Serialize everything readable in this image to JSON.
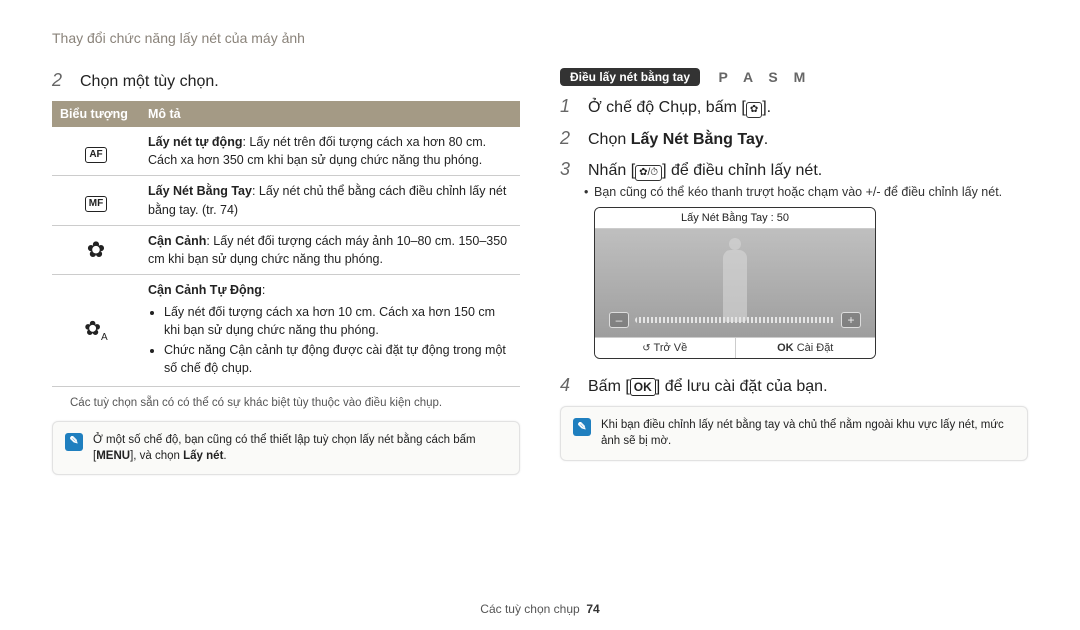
{
  "header": {
    "topic": "Thay đổi chức năng lấy nét của máy ảnh"
  },
  "left": {
    "step_number": "2",
    "step_text": "Chọn một tùy chọn.",
    "table_headers": {
      "icon": "Biểu tượng",
      "desc": "Mô tả"
    },
    "rows": [
      {
        "icon_label": "AF",
        "title": "Lấy nét tự động",
        "body": ": Lấy nét trên đối tượng cách xa hơn 80 cm. Cách xa hơn 350 cm khi bạn sử dụng chức năng thu phóng."
      },
      {
        "icon_label": "MF",
        "title": "Lấy Nét Bằng Tay",
        "body": ": Lấy nét chủ thể bằng cách điều chỉnh lấy nét bằng tay. (tr. 74)"
      },
      {
        "icon_label": "flower-icon",
        "title": "Cận Cảnh",
        "body": ": Lấy nét đối tượng cách máy ảnh 10–80 cm. 150–350 cm khi bạn sử dụng chức năng thu phóng."
      },
      {
        "icon_label": "auto-macro-icon",
        "title": "Cận Cảnh Tự Động",
        "body": "",
        "bullets": [
          "Lấy nét đối tượng cách xa hơn 10 cm. Cách xa hơn 150 cm khi bạn sử dụng chức năng thu phóng.",
          "Chức năng Cận cảnh tự động được cài đặt tự động trong một số chế độ chụp."
        ]
      }
    ],
    "note_small": "Các tuỳ chọn sẵn có có thể có sự khác biệt tùy thuộc vào điều kiện chụp.",
    "callout": {
      "pre": "Ở một số chế độ, bạn cũng có thể thiết lập tuỳ chọn lấy nét bằng cách bấm [",
      "key": "MENU",
      "post": "], và chọn ",
      "bold": "Lấy nét",
      "end": "."
    }
  },
  "right": {
    "mode_tag": "Điều lấy nét bằng tay",
    "mode_letters": "P A S M",
    "steps": [
      {
        "n": "1",
        "text": "Ở chế độ Chụp, bấm [",
        "glyph": "✿",
        "post": "]."
      },
      {
        "n": "2",
        "pre": "Chọn ",
        "bold": "Lấy Nét Bằng Tay",
        "post": "."
      },
      {
        "n": "3",
        "text": "Nhấn [",
        "glyph": "✿/⏱",
        "post": "] để điều chỉnh lấy nét."
      }
    ],
    "step3_bullet": "Bạn cũng có thể kéo thanh trượt hoặc chạm vào +/- để điều chỉnh lấy nét.",
    "cam": {
      "title": "Lấy Nét Bằng Tay : 50",
      "min_icon": "✿",
      "max_icon": "⛰",
      "back_label": "Trở Về",
      "ok_label": "OK",
      "set_label": "Cài Đặt"
    },
    "step4": {
      "n": "4",
      "pre": "Bấm [",
      "ok": "OK",
      "post": "] để lưu cài đặt của bạn."
    },
    "callout": "Khi bạn điều chỉnh lấy nét bằng tay và chủ thể nằm ngoài khu vực lấy nét, mức ảnh sẽ bị mờ."
  },
  "footer": {
    "section": "Các tuỳ chọn chụp",
    "page": "74"
  }
}
